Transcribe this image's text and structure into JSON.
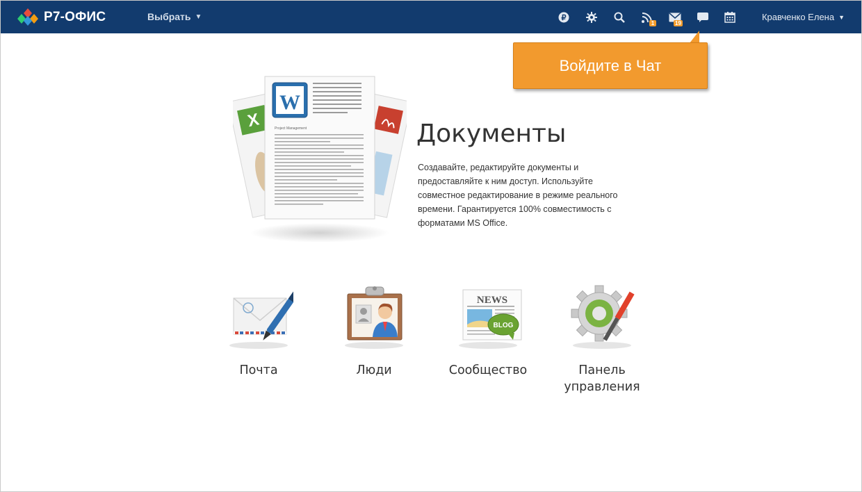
{
  "app": {
    "brand": "Р7-ОФИС",
    "menu_select_label": "Выбрать",
    "user_name": "Кравченко Елена"
  },
  "toolbar": {
    "icons": [
      "ruble-icon",
      "gear-icon",
      "search-icon",
      "feed-icon",
      "mail-icon",
      "chat-icon",
      "calendar-icon"
    ],
    "feed_badge": "1",
    "mail_badge": "19"
  },
  "callout": {
    "text": "Войдите в Чат"
  },
  "documents": {
    "title": "Документы",
    "description": "Создавайте, редактируйте документы и предоставляйте к ним доступ. Используйте совместное редактирование в режиме реального времени. Гарантируется 100% совместимость с форматами MS Office.",
    "preview_heading": "Project Management"
  },
  "modules": [
    {
      "label": "Почта",
      "icon": "mail-envelope-icon"
    },
    {
      "label": "Люди",
      "icon": "people-icon"
    },
    {
      "label": "Сообщество",
      "icon": "news-blog-icon",
      "icon_text_news": "NEWS",
      "icon_text_blog": "BLOG"
    },
    {
      "label": "Панель управления",
      "icon": "control-panel-icon"
    }
  ],
  "colors": {
    "topbar": "#123b6e",
    "accent": "#f29a2e",
    "text": "#333333"
  }
}
